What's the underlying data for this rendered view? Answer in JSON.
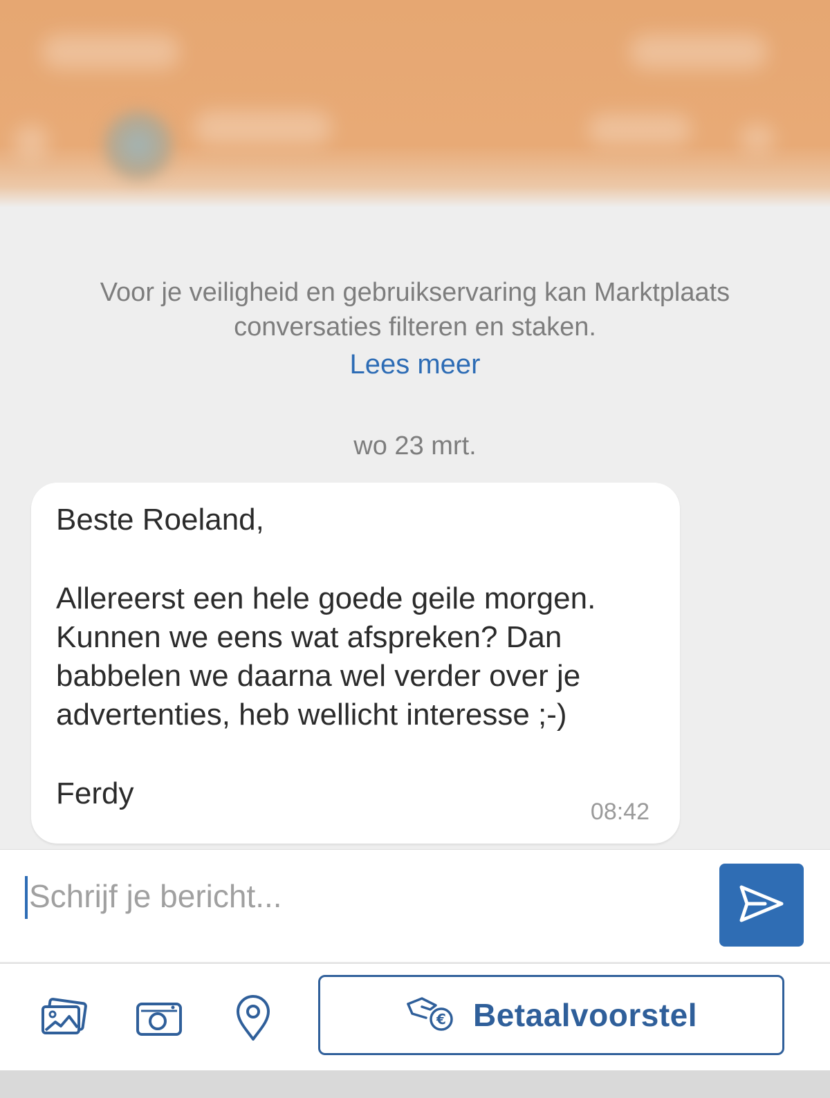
{
  "colors": {
    "header_bg": "#e6a772",
    "background": "#eeeeee",
    "link": "#2d6cb5",
    "send_button": "#2f6db4",
    "pay_button_border": "#2f5f9a"
  },
  "notice": {
    "line1": "Voor je veiligheid en gebruikservaring kan Marktplaats",
    "line2": "conversaties filteren en staken.",
    "link_label": "Lees meer"
  },
  "date_separator": "wo 23 mrt.",
  "message": {
    "lines": [
      "Beste Roeland,",
      "Allereerst een hele goede geile morgen.",
      "Kunnen we eens wat afspreken? Dan",
      "babbelen we daarna wel verder over je",
      "advertenties, heb wellicht interesse ;-)",
      "Ferdy"
    ],
    "time": "08:42"
  },
  "composer": {
    "placeholder": "Schrijf je bericht...",
    "value": "",
    "send_icon": "send-icon"
  },
  "toolbar": {
    "icons": [
      "gallery-icon",
      "camera-icon",
      "location-pin-icon"
    ],
    "pay_icon": "payment-hand-euro-icon",
    "pay_label": "Betaalvoorstel"
  }
}
